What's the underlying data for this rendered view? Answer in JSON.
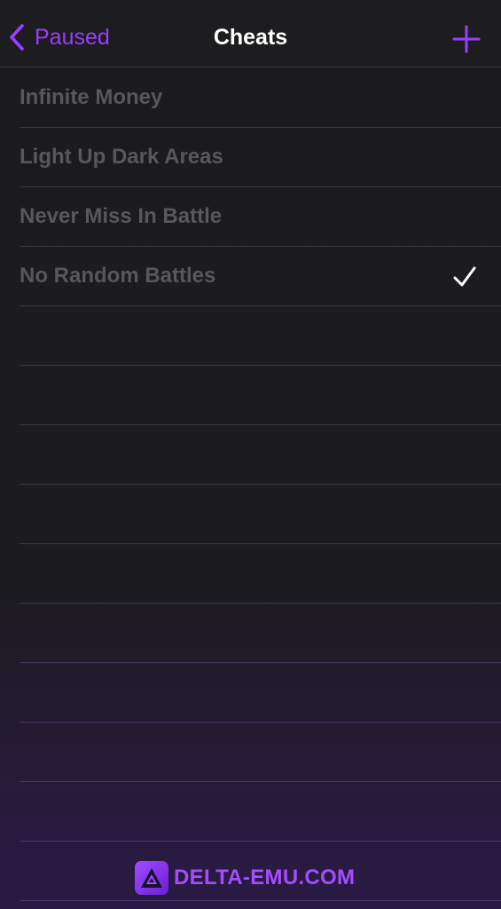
{
  "navbar": {
    "back_label": "Paused",
    "title": "Cheats",
    "back_icon": "chevron-left-icon",
    "add_icon": "plus-icon"
  },
  "cheats": [
    {
      "name": "Infinite Money",
      "enabled": false
    },
    {
      "name": "Light Up Dark Areas",
      "enabled": false
    },
    {
      "name": "Never Miss In Battle",
      "enabled": false
    },
    {
      "name": "No Random Battles",
      "enabled": true
    }
  ],
  "watermark": {
    "text": "DELTA-EMU.COM",
    "logo_icon": "delta-logo-icon"
  },
  "colors": {
    "accent": "#9b3dff",
    "title": "#ffffff",
    "row_text": "#58585b",
    "checkmark": "#ffffff",
    "background": "#1b1b1d"
  }
}
